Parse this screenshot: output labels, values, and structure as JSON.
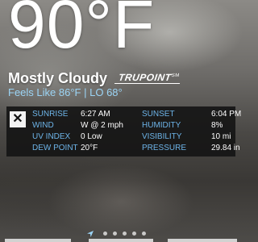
{
  "current": {
    "temperature": "90°F",
    "condition": "Mostly Cloudy",
    "feels_like": "Feels Like 86°F",
    "separator": "|",
    "low": "LO 68°"
  },
  "brand": {
    "name": "TRUPOINT",
    "mark": "SM"
  },
  "details": {
    "close_symbol": "✕",
    "rows": [
      {
        "label1": "SUNRISE",
        "value1": "6:27 AM",
        "label2": "SUNSET",
        "value2": "6:04 PM"
      },
      {
        "label1": "WIND",
        "value1": "W @ 2 mph",
        "label2": "HUMIDITY",
        "value2": "8%"
      },
      {
        "label1": "UV INDEX",
        "value1": "0 Low",
        "label2": "VISIBILITY",
        "value2": "10 mi"
      },
      {
        "label1": "DEW POINT",
        "value1": "20°F",
        "label2": "PRESSURE",
        "value2": "29.84 in"
      }
    ]
  },
  "pager": {
    "page_count": 5,
    "active_page": 1
  },
  "colors": {
    "label_blue": "#6db4e8",
    "feels_like_blue": "#9bd4f5"
  }
}
